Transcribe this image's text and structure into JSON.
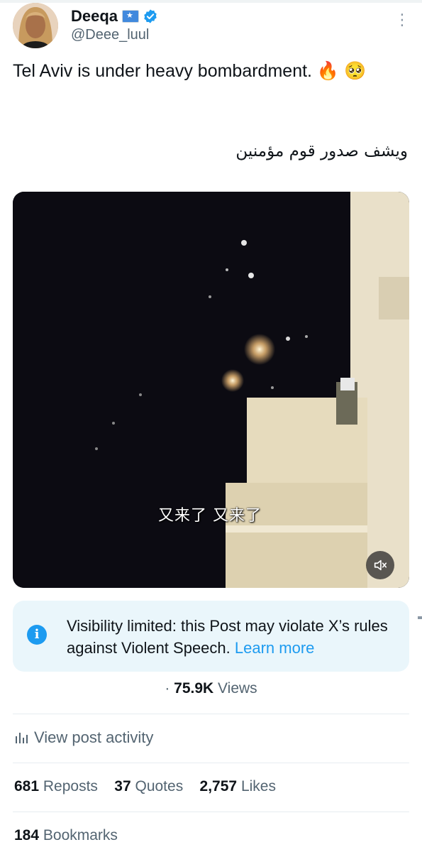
{
  "author": {
    "name": "Deeqa",
    "handle": "@Deee_luul",
    "flag_icon": "somalia-flag-icon",
    "verified_icon": "verified-badge-icon"
  },
  "post": {
    "text": "Tel Aviv is under heavy bombardment. 🔥 🥺",
    "arabic_text": "ويشف صدور قوم مؤمنين",
    "video_subtitle": "又来了 又来了"
  },
  "notice": {
    "text": "Visibility limited: this Post may violate X’s rules against Violent Speech.",
    "link": "Learn more"
  },
  "views": {
    "count": "75.9K",
    "label": "Views"
  },
  "activity_label": "View post activity",
  "stats": {
    "reposts_count": "681",
    "reposts_label": "Reposts",
    "quotes_count": "37",
    "quotes_label": "Quotes",
    "likes_count": "2,757",
    "likes_label": "Likes",
    "bookmarks_count": "184",
    "bookmarks_label": "Bookmarks"
  },
  "colors": {
    "accent": "#1d9bf0",
    "notice_bg": "#eaf6fb",
    "secondary_text": "#536471"
  }
}
